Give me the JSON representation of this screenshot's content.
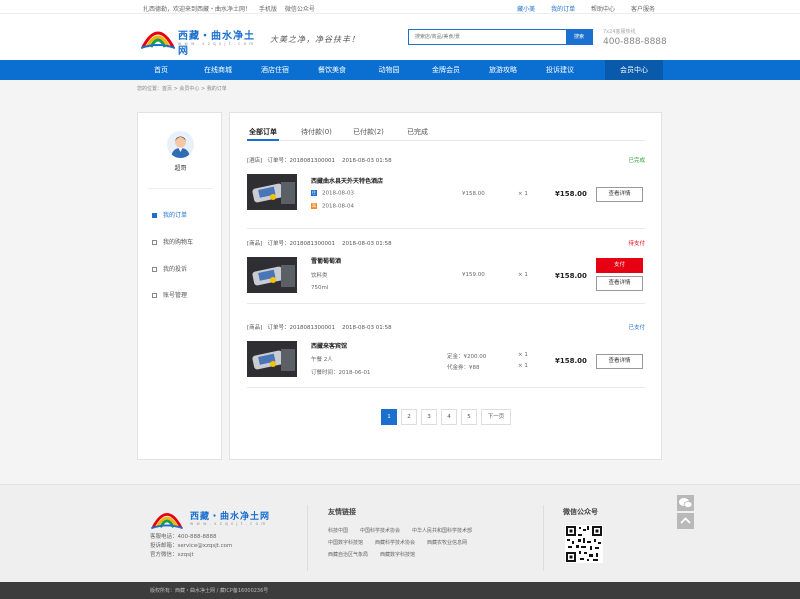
{
  "topbar": {
    "left": [
      "扎西德勒，欢迎来到西藏・曲水净土网！",
      "手机版",
      "微信公众号"
    ],
    "user": "藏小美",
    "my_orders": "我的订单",
    "help": "帮助中心",
    "service": "客户服务"
  },
  "header": {
    "logo_text": "西藏・曲水净土网",
    "logo_sub": "w w w . x z q s j t . c o m",
    "slogan": "大美之净，净谷扶丰！",
    "search_placeholder": "搜索店/商品/美食/景",
    "search_button": "搜索",
    "hotline_label": "7x24客服热线",
    "hotline_number": "400-888-8888"
  },
  "nav": [
    "首页",
    "在线商城",
    "酒店住宿",
    "餐饮美食",
    "动物园",
    "金牌会员",
    "旅游攻略",
    "投诉建议",
    "会员中心"
  ],
  "breadcrumb": "您的位置：首页 > 会员中心 > 我的订单",
  "sidebar": {
    "username": "超哥",
    "menu": [
      "我的订单",
      "我的购物车",
      "我的投诉",
      "账号管理"
    ]
  },
  "tabs": [
    "全部订单",
    "待付款(0)",
    "已付款(2)",
    "已完成"
  ],
  "orders": [
    {
      "type": "[酒店]",
      "order_no": "订单号：2018081300001",
      "time": "2018-08-03 01:58",
      "status": "已完成",
      "status_color": "#2aa13c",
      "name": "西藏曲水县天外天特色酒店",
      "line1_badge": "住",
      "line1": "2018-08-03",
      "line2_badge": "离",
      "line2": "2018-08-04",
      "price": "¥158.00",
      "qty": "× 1",
      "total": "¥158.00",
      "btn1": "查看详情"
    },
    {
      "type": "[商品]",
      "order_no": "订单号：2018081300001",
      "time": "2018-08-03 01:58",
      "status": "待支付",
      "status_color": "#e60012",
      "name": "雪葡萄萄酒",
      "line1": "饮料类",
      "line2": "750ml",
      "price": "¥159.00",
      "qty": "× 1",
      "total": "¥158.00",
      "btn_pay": "支付",
      "btn1": "查看详情"
    },
    {
      "type": "[商品]",
      "order_no": "订单号：2018081300001",
      "time": "2018-08-03 01:58",
      "status": "已支付",
      "status_color": "#1a6fcf",
      "name": "西藏来客宾馆",
      "line1": "午餐  2人",
      "line2": "订餐时间：2018-06-01",
      "price": "定金：¥200.00",
      "price2": "代金券：¥88",
      "qty": "× 1",
      "qty2": "× 1",
      "total": "¥158.00",
      "btn1": "查看详情"
    }
  ],
  "pagination": [
    "1",
    "2",
    "3",
    "4",
    "5",
    "下一页"
  ],
  "footer": {
    "logo_text": "西藏・曲水净土网",
    "logo_sub": "w w w . x z q s j t . c o m",
    "phone": "客服电话：400-888-8888",
    "email": "投诉邮箱：service@xzqsjt.com",
    "wechat": "官方微信：xzqsjt",
    "links_title": "友情链接",
    "links": [
      [
        "科技中国",
        "中国科学技术协会",
        "中华人民共和国科学技术部"
      ],
      [
        "中国数字科技馆",
        "西藏科学技术协会",
        "西藏农牧业信息网"
      ],
      [
        "西藏自治区气象局",
        "西藏数字科技馆"
      ]
    ],
    "wechat_title": "微信公众号",
    "copyright": "版权所有：西藏・曲水净土网 / 藏ICP备16000236号"
  },
  "colors": {
    "brand": "#0a6fd0",
    "nav_active": "#0a5aab",
    "pay": "#e60012"
  }
}
